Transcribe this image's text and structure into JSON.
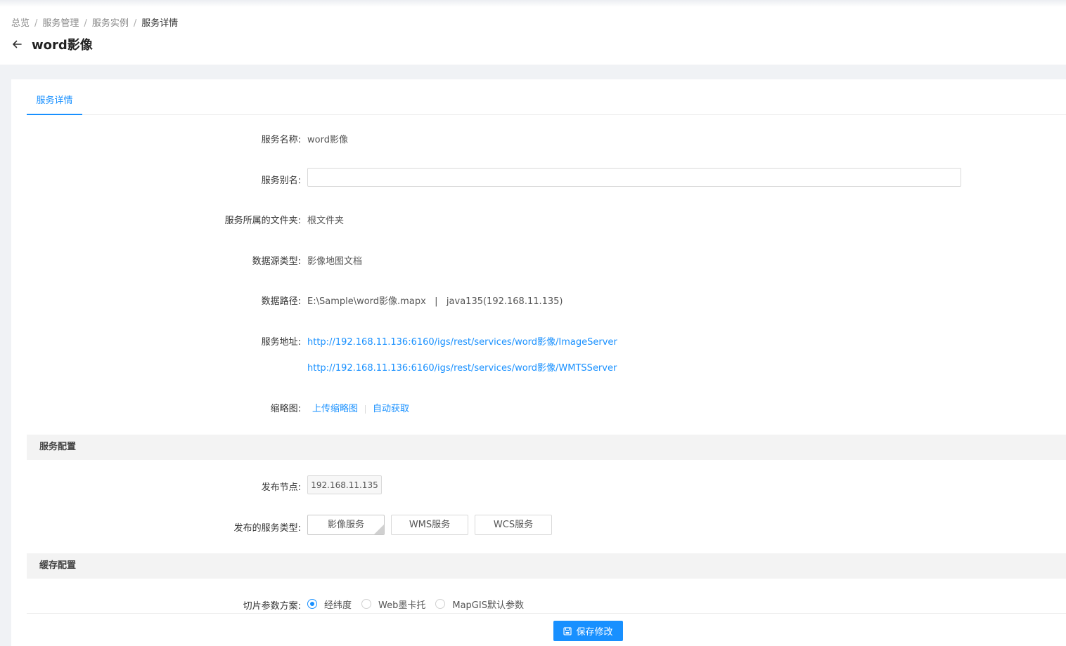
{
  "breadcrumb": {
    "items": [
      "总览",
      "服务管理",
      "服务实例"
    ],
    "current": "服务详情",
    "separator": "/"
  },
  "header": {
    "title": "word影像"
  },
  "tabs": [
    {
      "label": "服务详情",
      "active": true
    }
  ],
  "form": {
    "service_name": {
      "label": "服务名称:",
      "value": "word影像"
    },
    "service_alias": {
      "label": "服务别名:",
      "value": "",
      "placeholder": ""
    },
    "folder": {
      "label": "服务所属的文件夹:",
      "value": "根文件夹"
    },
    "datasource_type": {
      "label": "数据源类型:",
      "value": "影像地图文档"
    },
    "data_path": {
      "label": "数据路径:",
      "value": "E:\\Sample\\word影像.mapx   |   java135(192.168.11.135)"
    },
    "service_urls": {
      "label": "服务地址:",
      "links": [
        "http://192.168.11.136:6160/igs/rest/services/word影像/ImageServer",
        "http://192.168.11.136:6160/igs/rest/services/word影像/WMTSServer"
      ]
    },
    "thumbnail": {
      "label": "缩略图:",
      "upload": "上传缩略图",
      "auto": "自动获取"
    }
  },
  "service_config": {
    "title": "服务配置",
    "node": {
      "label": "发布节点:",
      "value": "192.168.11.135"
    },
    "types": {
      "label": "发布的服务类型:",
      "options": [
        {
          "label": "影像服务",
          "selected": true
        },
        {
          "label": "WMS服务",
          "selected": false
        },
        {
          "label": "WCS服务",
          "selected": false
        }
      ]
    }
  },
  "cache_config": {
    "title": "缓存配置",
    "tile_scheme": {
      "label": "切片参数方案:",
      "options": [
        {
          "label": "经纬度",
          "checked": true
        },
        {
          "label": "Web墨卡托",
          "checked": false
        },
        {
          "label": "MapGIS默认参数",
          "checked": false
        }
      ]
    }
  },
  "footer": {
    "save_label": "保存修改"
  },
  "colors": {
    "accent": "#1890ff",
    "background": "#f0f2f5",
    "section_bg": "#f3f3f3"
  }
}
